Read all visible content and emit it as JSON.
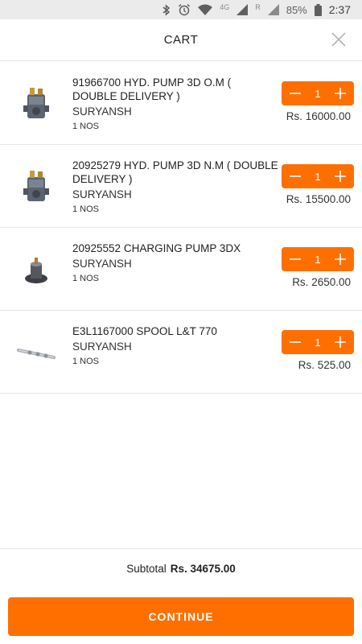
{
  "status_bar": {
    "network": "4G",
    "roaming": "R",
    "battery": "85%",
    "time": "2:37",
    "icons": [
      "bluetooth-icon",
      "alarm-icon",
      "wifi-icon",
      "signal-icon",
      "battery-icon"
    ]
  },
  "header": {
    "title": "CART",
    "close_icon": "close-icon"
  },
  "cart": {
    "items": [
      {
        "name": "91966700 HYD. PUMP 3D O.M ( DOUBLE DELIVERY )",
        "seller": "SURYANSH",
        "unit": "1 NOS",
        "quantity": "1",
        "price": "Rs. 16000.00",
        "thumbnail": "hydraulic-pump-image"
      },
      {
        "name": "20925279 HYD. PUMP 3D N.M ( DOUBLE DELIVERY )",
        "seller": "SURYANSH",
        "unit": "1 NOS",
        "quantity": "1",
        "price": "Rs. 15500.00",
        "thumbnail": "hydraulic-pump-image"
      },
      {
        "name": "20925552 CHARGING PUMP 3DX",
        "seller": "SURYANSH",
        "unit": "1 NOS",
        "quantity": "1",
        "price": "Rs. 2650.00",
        "thumbnail": "charging-pump-image"
      },
      {
        "name": "E3L1167000 SPOOL L&T 770",
        "seller": "SURYANSH",
        "unit": "1 NOS",
        "quantity": "1",
        "price": "Rs. 525.00",
        "thumbnail": "spool-image"
      }
    ]
  },
  "subtotal": {
    "label": "Subtotal",
    "value": "Rs. 34675.00"
  },
  "continue_label": "CONTINUE",
  "colors": {
    "accent": "#ff6f00",
    "status_bar": "#ebebeb",
    "divider": "#e6e6e6"
  }
}
